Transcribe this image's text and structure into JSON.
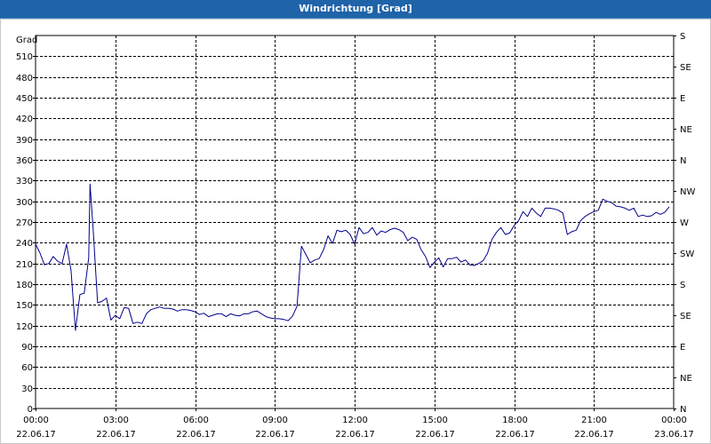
{
  "window": {
    "title": "Windrichtung [Grad]"
  },
  "colors": {
    "titlebar": "#1f63a8",
    "series": "#00008b",
    "grid": "#000000",
    "background": "#ffffff"
  },
  "chart_data": {
    "type": "line",
    "title": "Windrichtung [Grad]",
    "ylabel": "Grad",
    "grid": true,
    "ylim": [
      0,
      540
    ],
    "xlim": [
      "2017-06-22 00:00",
      "2017-06-23 00:00"
    ],
    "y_ticks": [
      0,
      30,
      60,
      90,
      120,
      150,
      180,
      210,
      240,
      270,
      300,
      330,
      360,
      390,
      420,
      450,
      480,
      510
    ],
    "y2_ticks": [
      {
        "value": 0,
        "label": "N"
      },
      {
        "value": 45,
        "label": "NE"
      },
      {
        "value": 90,
        "label": "E"
      },
      {
        "value": 135,
        "label": "SE"
      },
      {
        "value": 180,
        "label": "S"
      },
      {
        "value": 225,
        "label": "SW"
      },
      {
        "value": 270,
        "label": "W"
      },
      {
        "value": 315,
        "label": "NW"
      },
      {
        "value": 360,
        "label": "N"
      },
      {
        "value": 405,
        "label": "NE"
      },
      {
        "value": 450,
        "label": "E"
      },
      {
        "value": 495,
        "label": "SE"
      },
      {
        "value": 540,
        "label": "S"
      }
    ],
    "x_ticks": [
      {
        "time": "00:00",
        "date": "22.06.17"
      },
      {
        "time": "03:00",
        "date": "22.06.17"
      },
      {
        "time": "06:00",
        "date": "22.06.17"
      },
      {
        "time": "09:00",
        "date": "22.06.17"
      },
      {
        "time": "12:00",
        "date": "22.06.17"
      },
      {
        "time": "15:00",
        "date": "22.06.17"
      },
      {
        "time": "18:00",
        "date": "22.06.17"
      },
      {
        "time": "21:00",
        "date": "22.06.17"
      },
      {
        "time": "00:00",
        "date": "23.06.17"
      }
    ],
    "series": [
      {
        "values": [
          [
            "00:00",
            238
          ],
          [
            "00:10",
            225
          ],
          [
            "00:20",
            208
          ],
          [
            "00:30",
            210
          ],
          [
            "00:40",
            220
          ],
          [
            "00:50",
            213
          ],
          [
            "01:00",
            210
          ],
          [
            "01:10",
            238
          ],
          [
            "01:20",
            200
          ],
          [
            "01:30",
            113
          ],
          [
            "01:40",
            165
          ],
          [
            "01:50",
            167
          ],
          [
            "02:00",
            218
          ],
          [
            "02:03",
            325
          ],
          [
            "02:10",
            260
          ],
          [
            "02:20",
            153
          ],
          [
            "02:30",
            155
          ],
          [
            "02:40",
            160
          ],
          [
            "02:50",
            128
          ],
          [
            "03:00",
            135
          ],
          [
            "03:10",
            130
          ],
          [
            "03:20",
            146
          ],
          [
            "03:30",
            145
          ],
          [
            "03:40",
            123
          ],
          [
            "03:50",
            125
          ],
          [
            "04:00",
            123
          ],
          [
            "04:10",
            137
          ],
          [
            "04:20",
            143
          ],
          [
            "04:30",
            145
          ],
          [
            "04:40",
            147
          ],
          [
            "04:50",
            145
          ],
          [
            "05:00",
            145
          ],
          [
            "05:10",
            144
          ],
          [
            "05:20",
            141
          ],
          [
            "05:30",
            143
          ],
          [
            "05:40",
            143
          ],
          [
            "05:50",
            142
          ],
          [
            "06:00",
            140
          ],
          [
            "06:10",
            136
          ],
          [
            "06:20",
            138
          ],
          [
            "06:30",
            133
          ],
          [
            "06:40",
            135
          ],
          [
            "06:50",
            137
          ],
          [
            "07:00",
            137
          ],
          [
            "07:10",
            133
          ],
          [
            "07:20",
            137
          ],
          [
            "07:30",
            135
          ],
          [
            "07:40",
            134
          ],
          [
            "07:50",
            137
          ],
          [
            "08:00",
            137
          ],
          [
            "08:10",
            140
          ],
          [
            "08:20",
            141
          ],
          [
            "08:30",
            137
          ],
          [
            "08:40",
            133
          ],
          [
            "08:50",
            131
          ],
          [
            "09:00",
            130
          ],
          [
            "09:10",
            130
          ],
          [
            "09:20",
            129
          ],
          [
            "09:30",
            127
          ],
          [
            "09:40",
            134
          ],
          [
            "09:50",
            148
          ],
          [
            "10:00",
            235
          ],
          [
            "10:10",
            223
          ],
          [
            "10:20",
            211
          ],
          [
            "10:30",
            215
          ],
          [
            "10:40",
            217
          ],
          [
            "10:50",
            230
          ],
          [
            "11:00",
            250
          ],
          [
            "11:10",
            239
          ],
          [
            "11:20",
            258
          ],
          [
            "11:30",
            256
          ],
          [
            "11:40",
            258
          ],
          [
            "11:50",
            252
          ],
          [
            "12:00",
            238
          ],
          [
            "12:10",
            262
          ],
          [
            "12:20",
            253
          ],
          [
            "12:30",
            255
          ],
          [
            "12:40",
            262
          ],
          [
            "12:50",
            251
          ],
          [
            "13:00",
            257
          ],
          [
            "13:10",
            255
          ],
          [
            "13:20",
            259
          ],
          [
            "13:30",
            261
          ],
          [
            "13:40",
            259
          ],
          [
            "13:50",
            255
          ],
          [
            "14:00",
            243
          ],
          [
            "14:10",
            248
          ],
          [
            "14:20",
            245
          ],
          [
            "14:30",
            230
          ],
          [
            "14:40",
            220
          ],
          [
            "14:50",
            204
          ],
          [
            "15:00",
            212
          ],
          [
            "15:10",
            218
          ],
          [
            "15:20",
            205
          ],
          [
            "15:30",
            217
          ],
          [
            "15:40",
            217
          ],
          [
            "15:50",
            219
          ],
          [
            "16:00",
            212
          ],
          [
            "16:10",
            215
          ],
          [
            "16:20",
            208
          ],
          [
            "16:30",
            207
          ],
          [
            "16:40",
            210
          ],
          [
            "16:50",
            214
          ],
          [
            "17:00",
            225
          ],
          [
            "17:10",
            245
          ],
          [
            "17:20",
            255
          ],
          [
            "17:30",
            262
          ],
          [
            "17:40",
            252
          ],
          [
            "17:50",
            254
          ],
          [
            "18:00",
            265
          ],
          [
            "18:10",
            272
          ],
          [
            "18:20",
            285
          ],
          [
            "18:30",
            278
          ],
          [
            "18:40",
            290
          ],
          [
            "18:50",
            283
          ],
          [
            "19:00",
            278
          ],
          [
            "19:10",
            290
          ],
          [
            "19:20",
            290
          ],
          [
            "19:30",
            289
          ],
          [
            "19:40",
            287
          ],
          [
            "19:50",
            283
          ],
          [
            "20:00",
            252
          ],
          [
            "20:10",
            256
          ],
          [
            "20:20",
            258
          ],
          [
            "20:30",
            272
          ],
          [
            "20:40",
            278
          ],
          [
            "20:50",
            282
          ],
          [
            "21:00",
            285
          ],
          [
            "21:10",
            287
          ],
          [
            "21:20",
            303
          ],
          [
            "21:30",
            300
          ],
          [
            "21:40",
            298
          ],
          [
            "21:50",
            293
          ],
          [
            "22:00",
            292
          ],
          [
            "22:10",
            290
          ],
          [
            "22:20",
            287
          ],
          [
            "22:30",
            290
          ],
          [
            "22:40",
            278
          ],
          [
            "22:50",
            280
          ],
          [
            "23:00",
            278
          ],
          [
            "23:10",
            279
          ],
          [
            "23:20",
            284
          ],
          [
            "23:30",
            281
          ],
          [
            "23:40",
            284
          ],
          [
            "23:50",
            292
          ]
        ]
      }
    ]
  }
}
